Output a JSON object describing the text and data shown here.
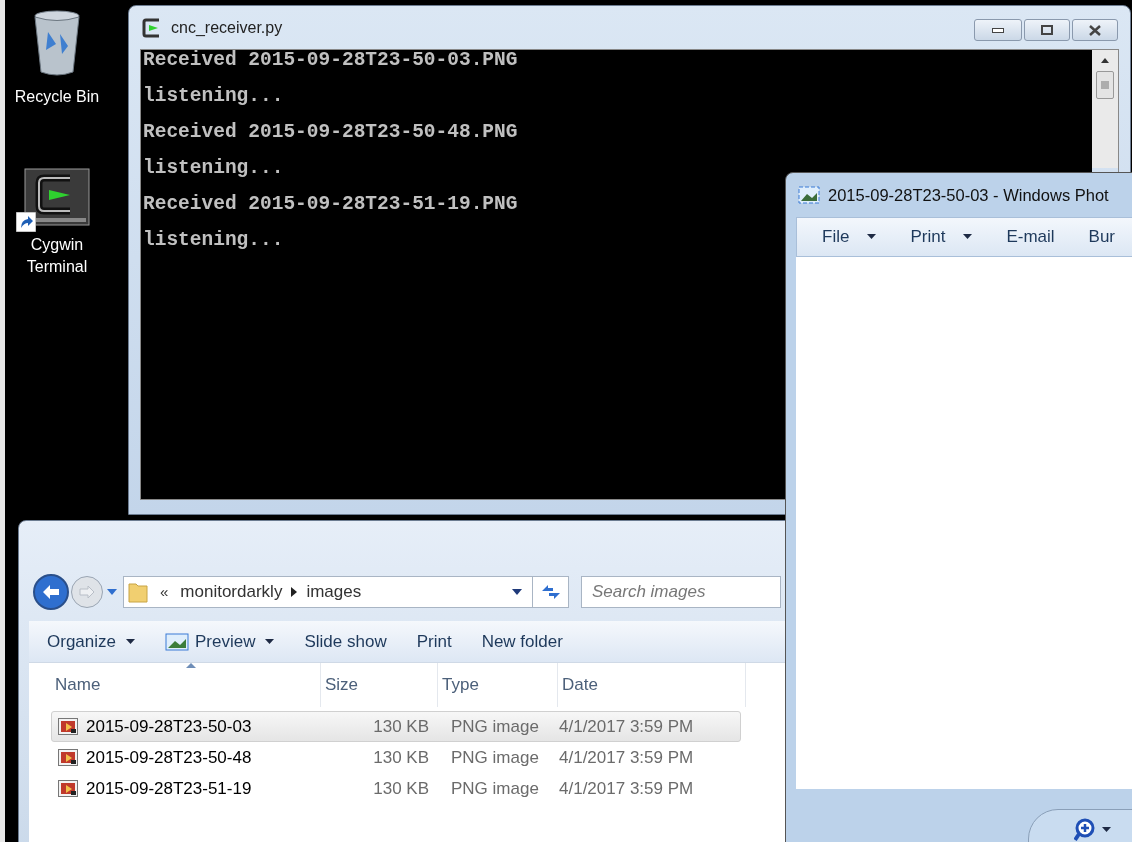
{
  "desktop_icons": [
    {
      "label": "Recycle Bin",
      "kind": "recycle"
    },
    {
      "label": "Cygwin Terminal",
      "kind": "shortcut"
    }
  ],
  "terminal": {
    "title": "cnc_receiver.py",
    "lines": [
      "Received 2015-09-28T23-50-03.PNG",
      "listening...",
      "Received 2015-09-28T23-50-48.PNG",
      "listening...",
      "Received 2015-09-28T23-51-19.PNG",
      "listening..."
    ]
  },
  "explorer": {
    "nav": {
      "back_enabled": true,
      "forward_enabled": false
    },
    "breadcrumb": {
      "overflow": "«",
      "items": [
        "monitordarkly",
        "images"
      ]
    },
    "search": {
      "placeholder": "Search images"
    },
    "toolbar": [
      {
        "label": "Organize",
        "menu": true,
        "icon": false
      },
      {
        "label": "Preview",
        "menu": true,
        "icon": true
      },
      {
        "label": "Slide show",
        "menu": false,
        "icon": false
      },
      {
        "label": "Print",
        "menu": false,
        "icon": false
      },
      {
        "label": "New folder",
        "menu": false,
        "icon": false
      }
    ],
    "columns": [
      {
        "label": "Name",
        "sorted": true
      },
      {
        "label": "Size",
        "sorted": false
      },
      {
        "label": "Type",
        "sorted": false
      },
      {
        "label": "Date",
        "sorted": false
      }
    ],
    "rows": [
      {
        "name": "2015-09-28T23-50-03",
        "size": "130 KB",
        "type": "PNG image",
        "date": "4/1/2017 3:59 PM",
        "selected": true
      },
      {
        "name": "2015-09-28T23-50-48",
        "size": "130 KB",
        "type": "PNG image",
        "date": "4/1/2017 3:59 PM",
        "selected": false
      },
      {
        "name": "2015-09-28T23-51-19",
        "size": "130 KB",
        "type": "PNG image",
        "date": "4/1/2017 3:59 PM",
        "selected": false
      }
    ]
  },
  "photo_viewer": {
    "title": "2015-09-28T23-50-03 - Windows Phot",
    "menu": [
      {
        "label": "File",
        "menu": true
      },
      {
        "label": "Print",
        "menu": true
      },
      {
        "label": "E-mail",
        "menu": false
      },
      {
        "label": "Bur",
        "menu": false
      }
    ]
  }
}
